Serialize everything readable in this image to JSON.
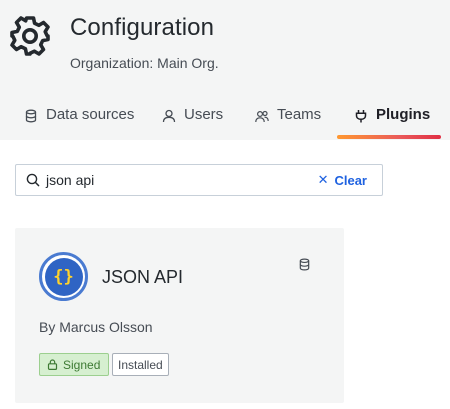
{
  "page": {
    "title": "Configuration",
    "subtitle": "Organization: Main Org."
  },
  "tabs": [
    {
      "label": "Data sources",
      "icon": "database-icon",
      "active": false
    },
    {
      "label": "Users",
      "icon": "user-icon",
      "active": false
    },
    {
      "label": "Teams",
      "icon": "users-icon",
      "active": false
    },
    {
      "label": "Plugins",
      "icon": "plug-icon",
      "active": true
    }
  ],
  "search": {
    "value": "json api",
    "clear_label": "Clear"
  },
  "plugin": {
    "name": "JSON API",
    "author": "By Marcus Olsson",
    "type_icon": "database-icon",
    "badges": {
      "signed": "Signed",
      "installed": "Installed"
    }
  },
  "colors": {
    "accent_blue": "#1f62e0",
    "active_tab_gradient": [
      "#ff9830",
      "#e02f44"
    ],
    "signed_green": "#3d7a33"
  }
}
